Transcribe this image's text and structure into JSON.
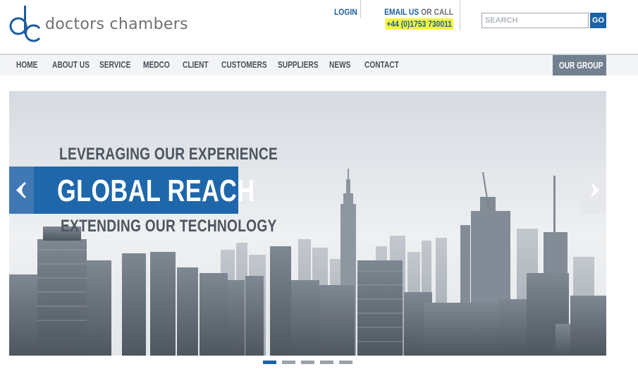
{
  "brand": {
    "name": "doctors chambers",
    "colors": {
      "primary": "#1a63a8",
      "text_gray": "#6f7076",
      "highlight": "#f5f53a",
      "our_group_bg": "#72808f"
    }
  },
  "header": {
    "login_label": "LOGIN",
    "email_label": "EMAIL US",
    "or_call_label": "OR CALL",
    "phone": "+44 (0)1753 730011",
    "search_placeholder": "SEARCH",
    "go_label": "GO"
  },
  "nav": {
    "items": [
      {
        "label": "HOME"
      },
      {
        "label": "ABOUT US"
      },
      {
        "label": "SERVICE"
      },
      {
        "label": "MEDCO"
      },
      {
        "label": "CLIENT"
      },
      {
        "label": "CUSTOMERS"
      },
      {
        "label": "SUPPLIERS"
      },
      {
        "label": "NEWS"
      },
      {
        "label": "CONTACT"
      }
    ],
    "our_group_label": "OUR GROUP"
  },
  "slider": {
    "line_top": "LEVERAGING OUR EXPERIENCE",
    "headline": "GLOBAL REACH",
    "line_bottom": "EXTENDING OUR TECHNOLOGY",
    "prev_icon": "chevron-left-icon",
    "next_icon": "chevron-right-icon",
    "slide_count": 5,
    "active_slide": 1
  }
}
